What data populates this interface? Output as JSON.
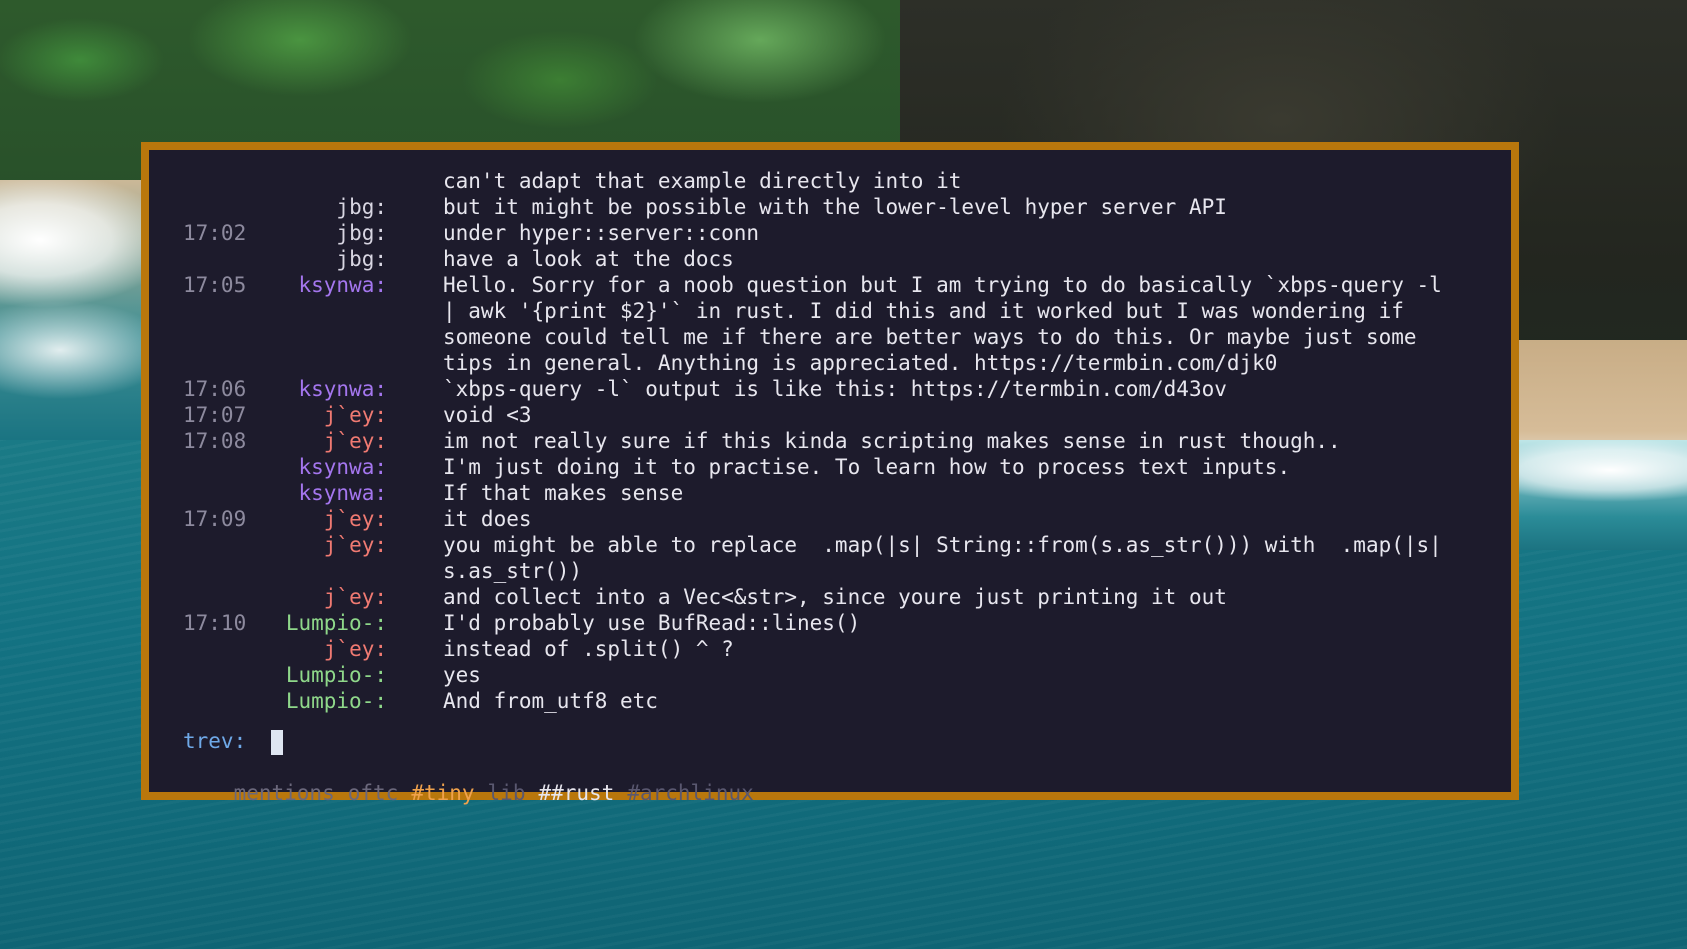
{
  "window": {
    "border_color": "#b9770c",
    "background_color": "#1d1b2c"
  },
  "colors": {
    "timestamp": "#8d8a9e",
    "text": "#e7e6ee",
    "nick_jbg": "#d8d6e2",
    "nick_ksynwa": "#a476ee",
    "nick_jey": "#f07a72",
    "nick_lumpio": "#8fd88a",
    "prompt_nick": "#6fa9e8",
    "active_tab": "#f0a24c"
  },
  "messages": [
    {
      "ts": "",
      "nick": "",
      "text": "can't adapt that example directly into it"
    },
    {
      "ts": "",
      "nick": "jbg:",
      "text": "but it might be possible with the lower-level hyper server API"
    },
    {
      "ts": "17:02",
      "nick": "jbg:",
      "text": "under hyper::server::conn"
    },
    {
      "ts": "",
      "nick": "jbg:",
      "text": "have a look at the docs"
    },
    {
      "ts": "17:05",
      "nick": "ksynwa:",
      "text": "Hello. Sorry for a noob question but I am trying to do basically `xbps-query -l"
    },
    {
      "ts": "",
      "nick": "",
      "text": "| awk '{print $2}'` in rust. I did this and it worked but I was wondering if"
    },
    {
      "ts": "",
      "nick": "",
      "text": "someone could tell me if there are better ways to do this. Or maybe just some"
    },
    {
      "ts": "",
      "nick": "",
      "text": "tips in general. Anything is appreciated. https://termbin.com/djk0"
    },
    {
      "ts": "17:06",
      "nick": "ksynwa:",
      "text": "`xbps-query -l` output is like this: https://termbin.com/d43ov"
    },
    {
      "ts": "17:07",
      "nick": "j`ey:",
      "text": "void <3"
    },
    {
      "ts": "17:08",
      "nick": "j`ey:",
      "text": "im not really sure if this kinda scripting makes sense in rust though.."
    },
    {
      "ts": "",
      "nick": "ksynwa:",
      "text": "I'm just doing it to practise. To learn how to process text inputs."
    },
    {
      "ts": "",
      "nick": "ksynwa:",
      "text": "If that makes sense"
    },
    {
      "ts": "17:09",
      "nick": "j`ey:",
      "text": "it does"
    },
    {
      "ts": "",
      "nick": "j`ey:",
      "text": "you might be able to replace  .map(|s| String::from(s.as_str())) with  .map(|s|"
    },
    {
      "ts": "",
      "nick": "",
      "text": "s.as_str())"
    },
    {
      "ts": "",
      "nick": "j`ey:",
      "text": "and collect into a Vec<&str>, since youre just printing it out"
    },
    {
      "ts": "17:10",
      "nick": "Lumpio-:",
      "text": "I'd probably use BufRead::lines()"
    },
    {
      "ts": "",
      "nick": "j`ey:",
      "text": "instead of .split() ^ ?"
    },
    {
      "ts": "",
      "nick": "Lumpio-:",
      "text": "yes"
    },
    {
      "ts": "",
      "nick": "Lumpio-:",
      "text": "And from_utf8 etc"
    }
  ],
  "input": {
    "prompt": "trev:",
    "value": ""
  },
  "tabs": [
    {
      "label": "mentions"
    },
    {
      "label": "oftc"
    },
    {
      "label": "#tiny"
    },
    {
      "label": "lib"
    },
    {
      "label": "##rust"
    },
    {
      "label": "#archlinux"
    }
  ]
}
